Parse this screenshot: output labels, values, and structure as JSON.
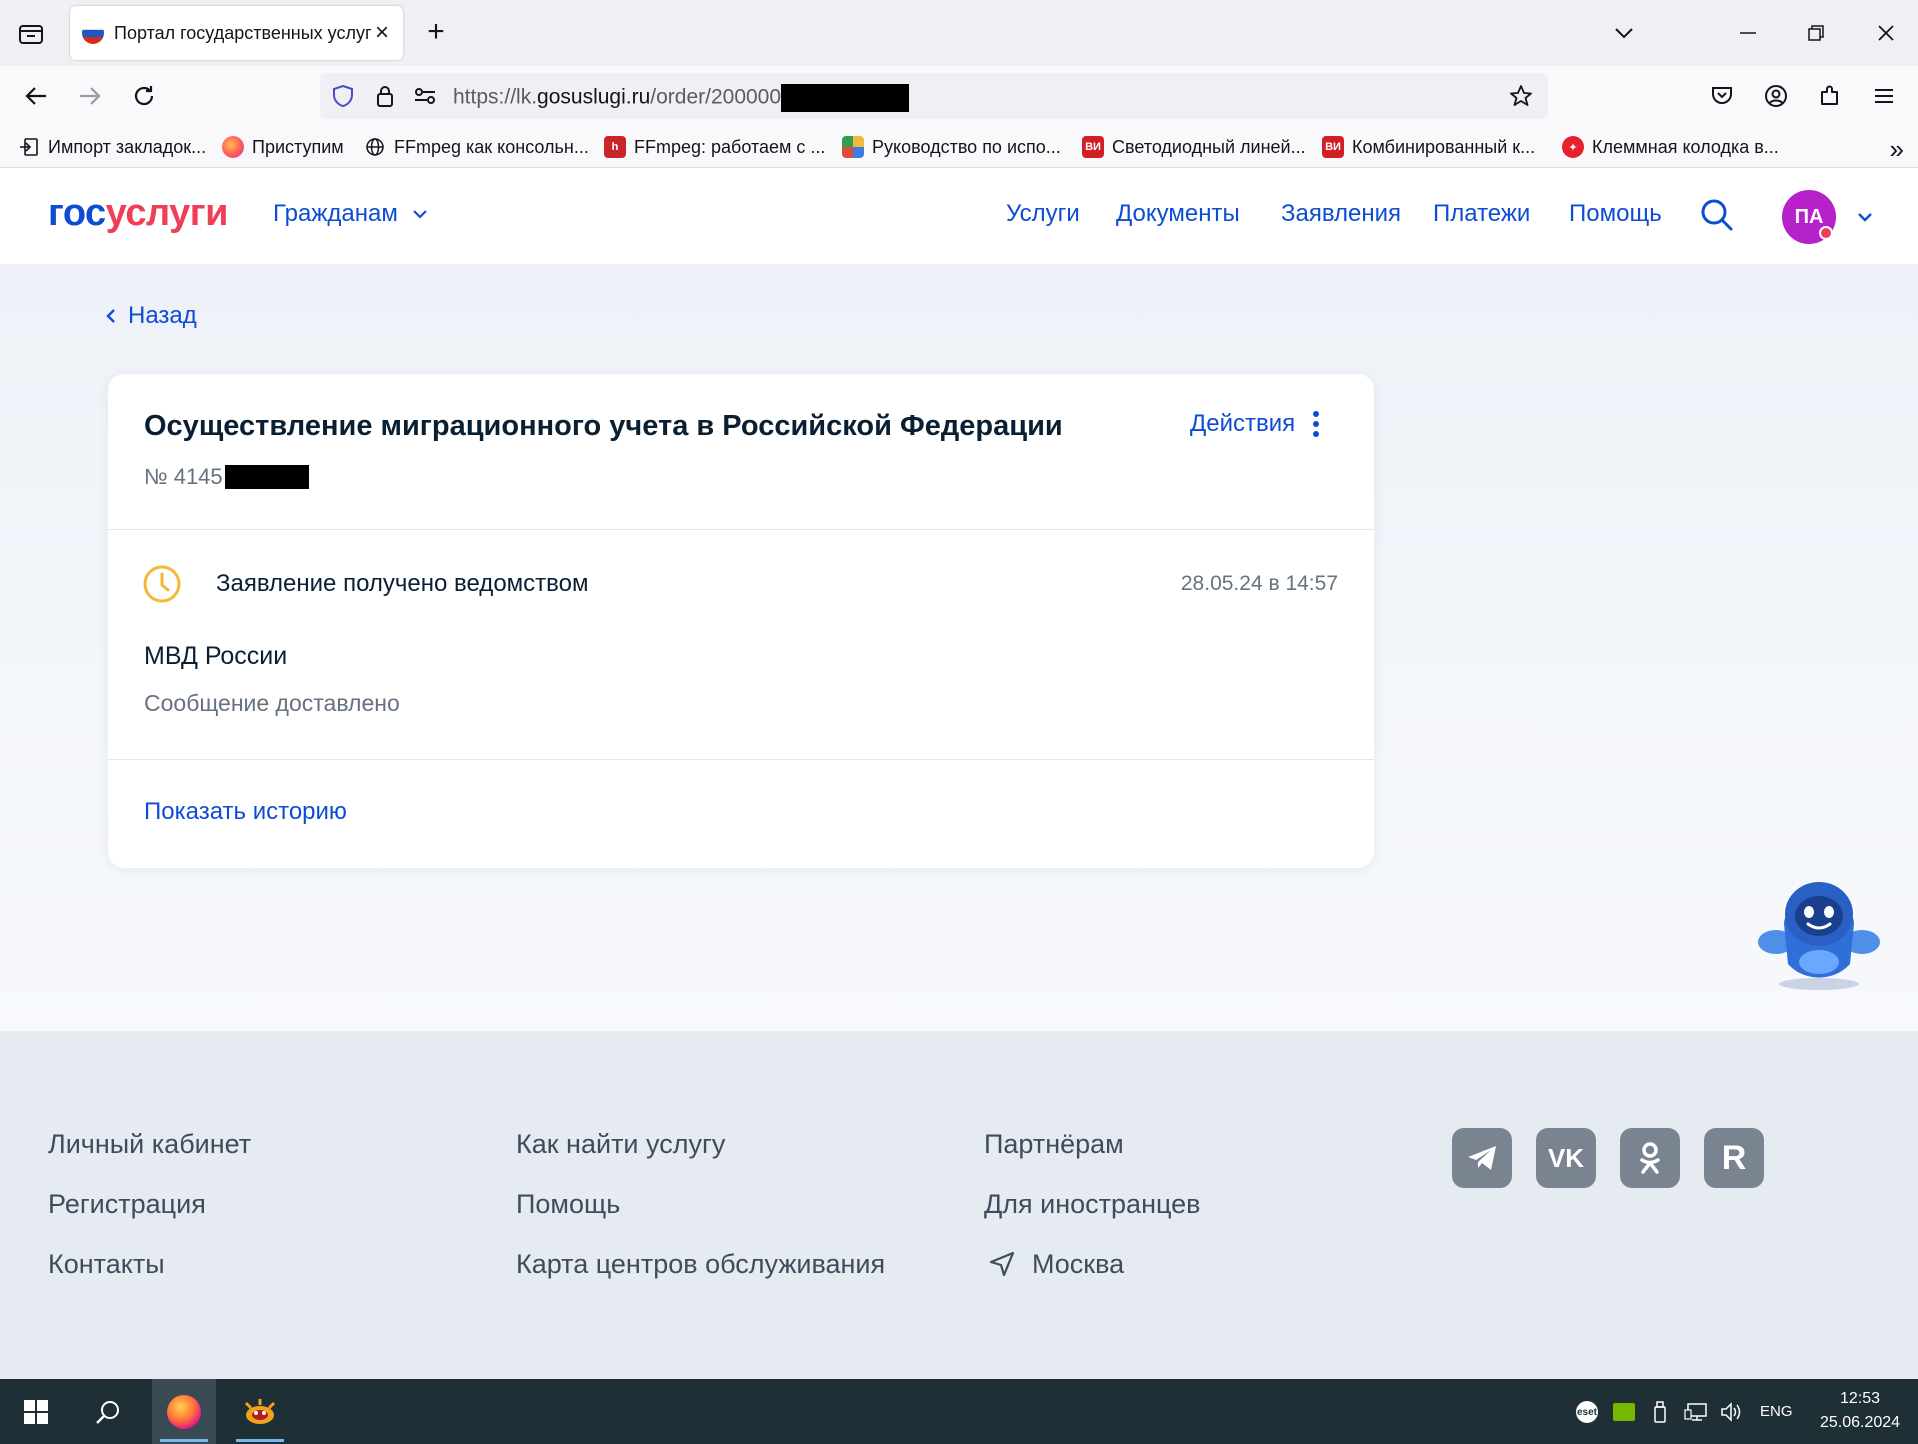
{
  "browser": {
    "tab_title": "Портал государственных услуг",
    "url_prefix": "https://lk.",
    "url_host": "gosuslugi.ru",
    "url_path": "/order/200000",
    "bookmarks": [
      {
        "label": "Импорт закладок..."
      },
      {
        "label": "Приступим"
      },
      {
        "label": "FFmpeg как консольн..."
      },
      {
        "label": "FFmpeg: работаем с ..."
      },
      {
        "label": "Руководство по испо..."
      },
      {
        "label": "Светодиодный линей..."
      },
      {
        "label": "Комбинированный к..."
      },
      {
        "label": "Клеммная колодка в..."
      }
    ]
  },
  "header": {
    "logo_part1": "гос",
    "logo_part2": "услуги",
    "role": "Гражданам",
    "nav": [
      "Услуги",
      "Документы",
      "Заявления",
      "Платежи",
      "Помощь"
    ],
    "avatar_initials": "ПА"
  },
  "main": {
    "back_label": "Назад",
    "card": {
      "title": "Осуществление миграционного учета в Российской Федерации",
      "actions_label": "Действия",
      "order_number": "№ 4145",
      "status": "Заявление получено ведомством",
      "status_date": "28.05.24 в 14:57",
      "agency": "МВД России",
      "agency_message": "Сообщение доставлено",
      "history_link": "Показать историю"
    }
  },
  "footer": {
    "col1": [
      "Личный кабинет",
      "Регистрация",
      "Контакты"
    ],
    "col2": [
      "Как найти услугу",
      "Помощь",
      "Карта центров обслуживания"
    ],
    "col3": [
      "Партнёрам",
      "Для иностранцев"
    ],
    "city": "Москва",
    "socials": [
      "telegram-icon",
      "vk-icon",
      "odnoklassniki-icon",
      "rutube-icon"
    ]
  },
  "taskbar": {
    "lang": "ENG",
    "time": "12:53",
    "date": "25.06.2024"
  },
  "colors": {
    "brand_blue": "#0d4cd3",
    "brand_red": "#ee3f58",
    "status_yellow": "#f2b83a",
    "avatar": "#b621c9"
  }
}
